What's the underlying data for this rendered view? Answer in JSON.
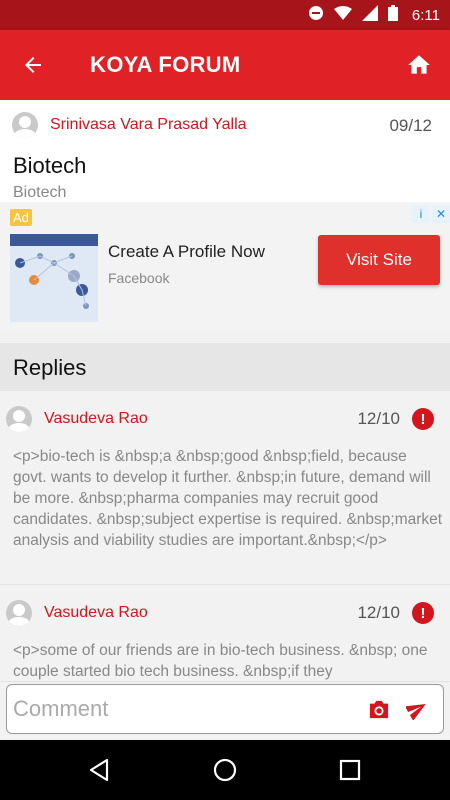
{
  "status_bar": {
    "time": "6:11"
  },
  "header": {
    "title": "KOYA FORUM"
  },
  "post": {
    "author": "Srinivasa Vara Prasad Yalla",
    "date": "09/12",
    "title": "Biotech",
    "body": "Biotech"
  },
  "ad": {
    "badge": "Ad",
    "headline": "Create A Profile Now",
    "advertiser": "Facebook",
    "button": "Visit Site"
  },
  "replies": {
    "header": "Replies",
    "items": [
      {
        "author": "Vasudeva Rao",
        "date": "12/10",
        "body": "<p>bio-tech is &nbsp;a &nbsp;good &nbsp;field, because govt. wants to develop it further. &nbsp;in future, demand will be more. &nbsp;pharma companies may recruit good candidates. &nbsp;subject expertise is required. &nbsp;market analysis and viability studies are important.&nbsp;</p>"
      },
      {
        "author": "Vasudeva Rao",
        "date": "12/10",
        "body": "<p>some of our friends are in bio-tech business. &nbsp; one couple started bio tech business. &nbsp;if they"
      }
    ]
  },
  "composer": {
    "placeholder": "Comment"
  },
  "colors": {
    "primary": "#e02126",
    "status_bar": "#a7141a",
    "accent_text": "#d1161d"
  },
  "icons": [
    "back-arrow-icon",
    "home-icon",
    "camera-icon",
    "send-icon",
    "report-icon",
    "info-icon",
    "close-icon"
  ]
}
